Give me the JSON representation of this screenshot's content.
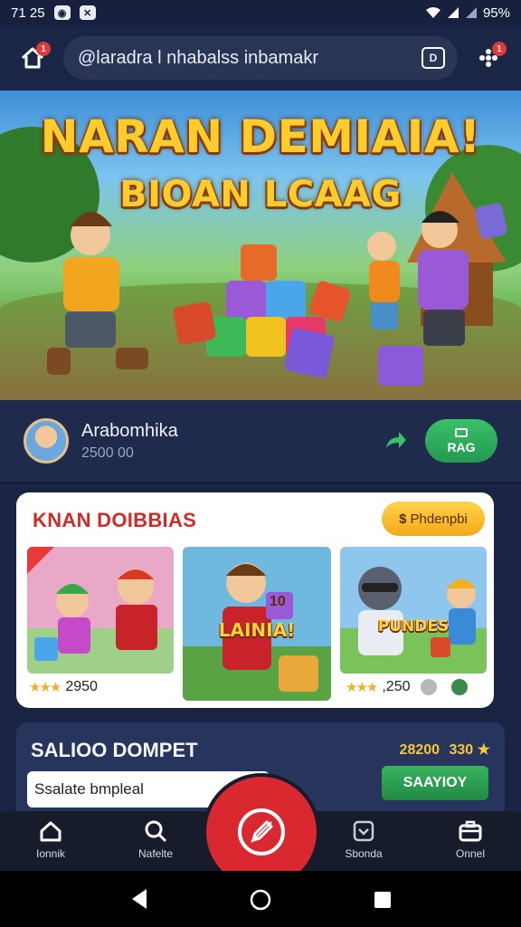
{
  "status_bar": {
    "time": "71 25",
    "battery": "95%"
  },
  "browser": {
    "home_badge": "1",
    "url": "@laradra l nhabalss inbamakr",
    "menu_badge": "1",
    "tab_icon_text": "D"
  },
  "hero": {
    "title_line1": "NARAN DEMIAIA!",
    "title_line2": "BIOAN LCAAG"
  },
  "profile": {
    "name": "Arabomhika",
    "subtitle": "2500 00",
    "play_label": "RAG"
  },
  "games": {
    "title": "KNAN DOIBBIAS",
    "promo_label": "Phdenpbi",
    "tiles": [
      {
        "label": "",
        "rating_value": "2950"
      },
      {
        "label": "LAINIA!",
        "banner": "10"
      },
      {
        "label": "PUNDES",
        "rating_value": ",250"
      }
    ]
  },
  "wallet": {
    "title": "SALIOO DOMPET",
    "amount": "28200",
    "amount_suffix": "330",
    "input_value": "Ssalate bmpleal",
    "button_label": "SAAYIOY"
  },
  "bottom_nav": {
    "items": [
      "Ionnik",
      "Nafelte",
      "Sbonda",
      "Onnel"
    ]
  },
  "colors": {
    "accent_red": "#d9282f",
    "accent_green": "#2fae5c",
    "gold": "#ffcc2e",
    "background": "#1a2442"
  },
  "icons": [
    "home-icon",
    "tab-switcher-icon",
    "menu-dots-icon",
    "share-icon",
    "search-icon",
    "pencil-icon",
    "shield-icon",
    "briefcase-icon",
    "back-icon",
    "home-circle-icon",
    "recents-icon"
  ]
}
